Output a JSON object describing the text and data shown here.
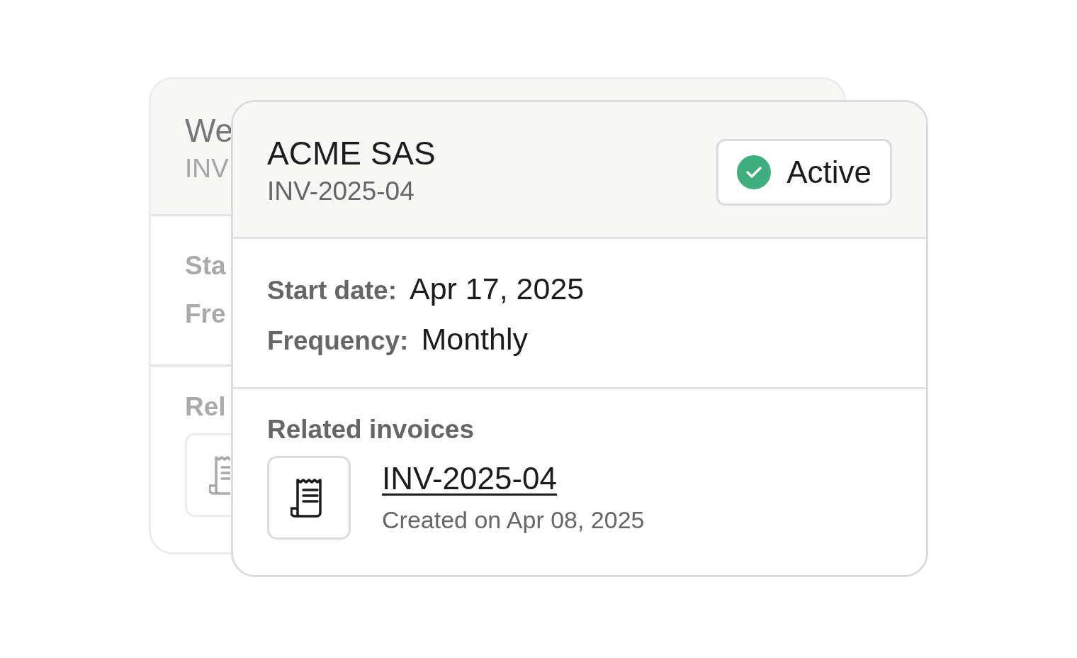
{
  "back_card": {
    "title": "We",
    "subtitle": "INV",
    "fields": [
      "Sta",
      "Fre"
    ],
    "section_title": "Rel"
  },
  "card": {
    "title": "ACME SAS",
    "subtitle": "INV-2025-04",
    "status": {
      "label": "Active",
      "active": true
    },
    "fields": [
      {
        "label": "Start date:",
        "value": "Apr 17, 2025"
      },
      {
        "label": "Frequency:",
        "value": "Monthly"
      }
    ],
    "section_title": "Related invoices",
    "invoices": [
      {
        "number": "INV-2025-04",
        "created": "Created on Apr 08, 2025"
      }
    ]
  }
}
